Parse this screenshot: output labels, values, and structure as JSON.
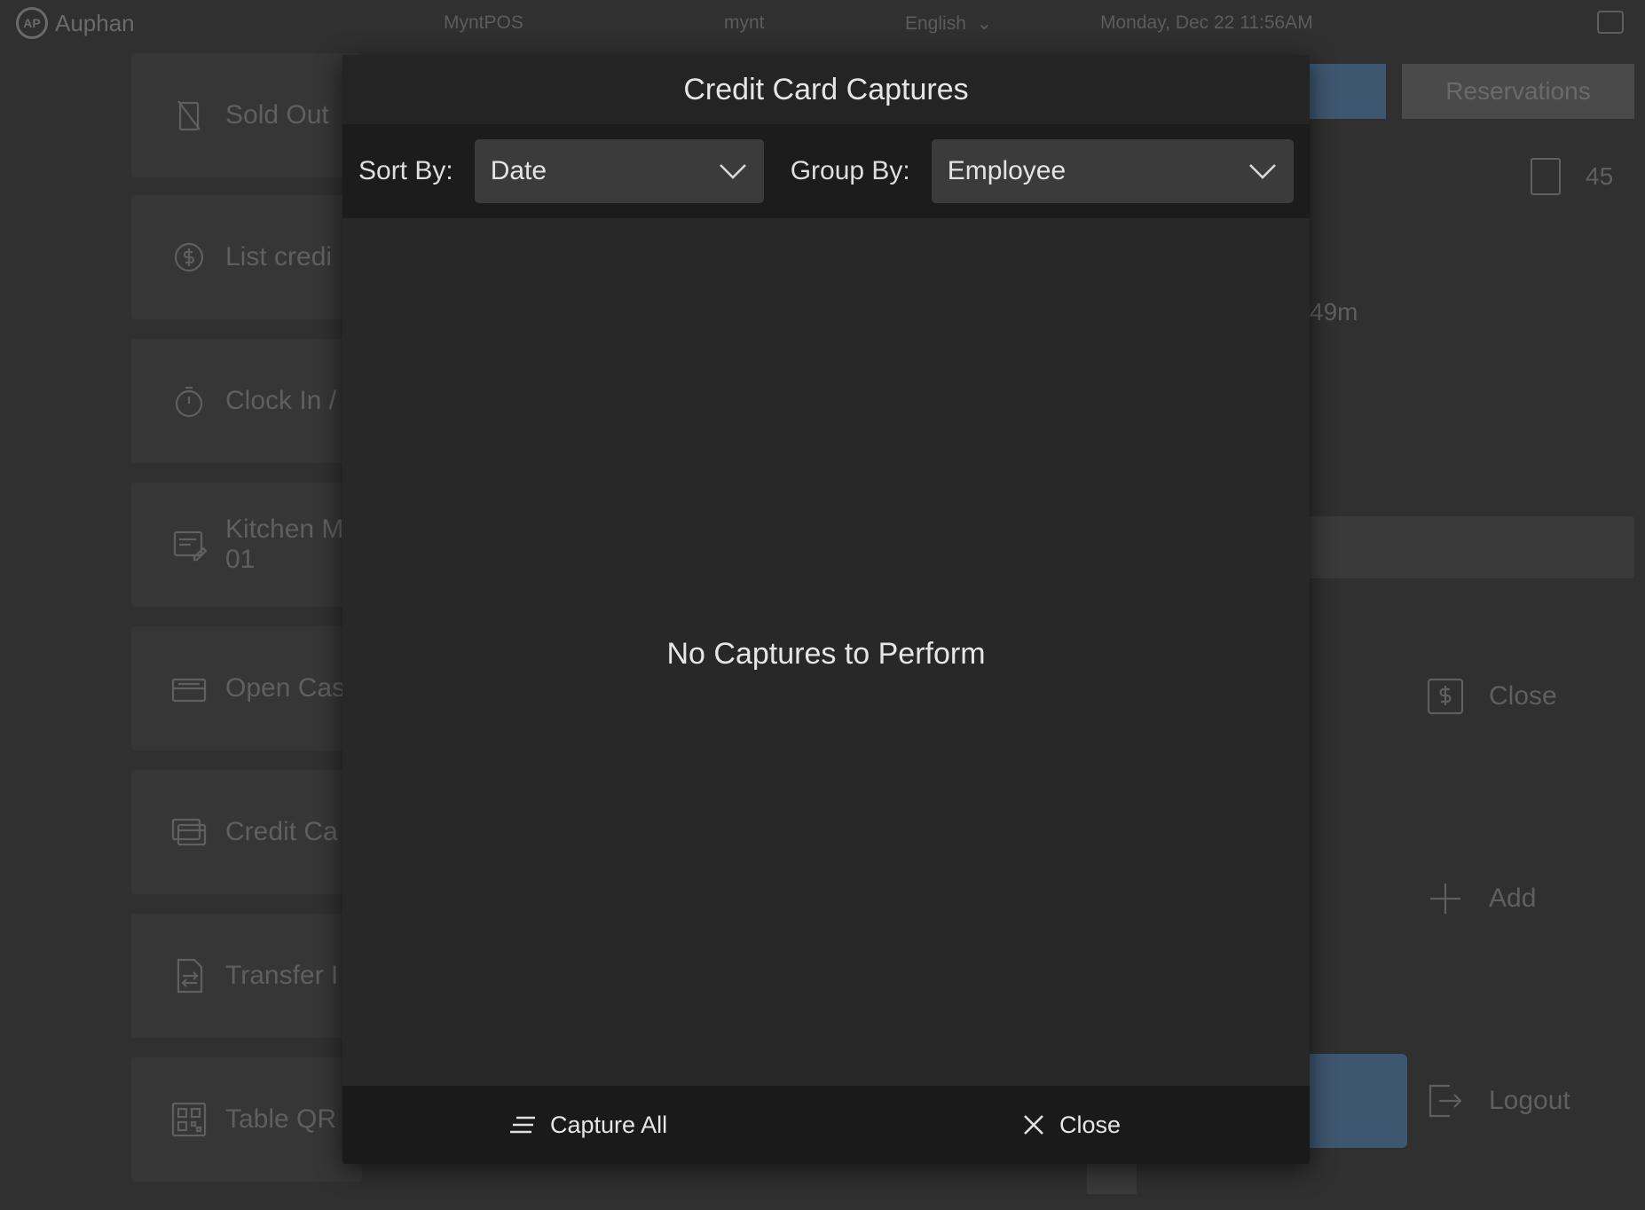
{
  "topbar": {
    "brand": "Auphan",
    "logo_mark": "AP",
    "store": "MyntPOS",
    "user": "mynt",
    "language": "English",
    "datetime": "Monday, Dec 22 11:56AM"
  },
  "left_menu": [
    {
      "label": "Sold Out",
      "icon": "sold-out-icon"
    },
    {
      "label": "List credi",
      "icon": "credit-list-icon"
    },
    {
      "label": "Clock In /",
      "icon": "stopwatch-icon"
    },
    {
      "label": "Kitchen M",
      "sublabel": "01",
      "icon": "kitchen-note-icon"
    },
    {
      "label": "Open Cas",
      "icon": "cash-drawer-icon"
    },
    {
      "label": "Credit Ca",
      "icon": "credit-card-icon"
    },
    {
      "label": "Transfer I",
      "icon": "transfer-doc-icon"
    },
    {
      "label": "Table QR",
      "icon": "qr-code-icon"
    }
  ],
  "right_panel": {
    "reservations_label": "Reservations",
    "count": "45",
    "elapsed": "49m",
    "close_label": "Close",
    "add_label": "Add",
    "logout_label": "Logout"
  },
  "modal": {
    "title": "Credit Card Captures",
    "sort_label": "Sort By:",
    "sort_value": "Date",
    "group_label": "Group By:",
    "group_value": "Employee",
    "empty_message": "No Captures to Perform",
    "capture_all_label": "Capture All",
    "close_label": "Close"
  }
}
